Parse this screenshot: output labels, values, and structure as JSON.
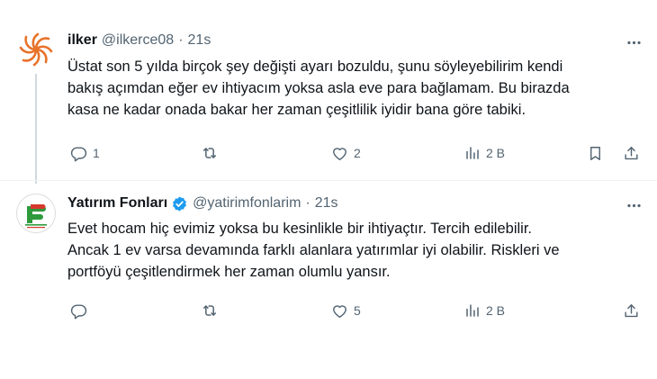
{
  "tweets": [
    {
      "author": {
        "name": "ilker",
        "handle": "@ilkerce08"
      },
      "dot": "·",
      "time": "21s",
      "text_lines": [
        "Üstat son 5 yılda birçok şey değişti ayarı bozuldu, şunu söyleyebilirim kendi",
        "bakış açımdan eğer ev ihtiyacım yoksa asla eve para bağlamam. Bu birazda",
        "kasa ne kadar onada bakar her zaman çeşitlilik iyidir bana göre tabiki."
      ],
      "actions": {
        "replies": "1",
        "retweets": "",
        "likes": "2",
        "views": "2 B"
      }
    },
    {
      "author": {
        "name": "Yatırım Fonları",
        "handle": "@yatirimfonlarim",
        "verified": true
      },
      "dot": "·",
      "time": "21s",
      "text_lines": [
        "Evet hocam hiç evimiz yoksa bu kesinlikle bir ihtiyaçtır. Tercih edilebilir.",
        "Ancak 1 ev varsa devamında farklı alanlara yatırımlar iyi olabilir. Riskleri ve",
        "portföyü çeşitlendirmek her zaman olumlu yansır."
      ],
      "actions": {
        "replies": "",
        "retweets": "",
        "likes": "5",
        "views": "2 B"
      }
    }
  ],
  "colors": {
    "text": "#0f1419",
    "secondary": "#536471",
    "verified": "#1d9bf0",
    "logo_green": "#2e9a3c",
    "logo_red": "#d63a2f",
    "avatar_orange": "#e8732a"
  },
  "icons": {
    "more": "more-horizontal-icon",
    "reply": "reply-icon",
    "retweet": "retweet-icon",
    "like": "heart-icon",
    "views": "views-chart-icon",
    "share": "share-icon",
    "verified": "verified-badge-icon"
  }
}
